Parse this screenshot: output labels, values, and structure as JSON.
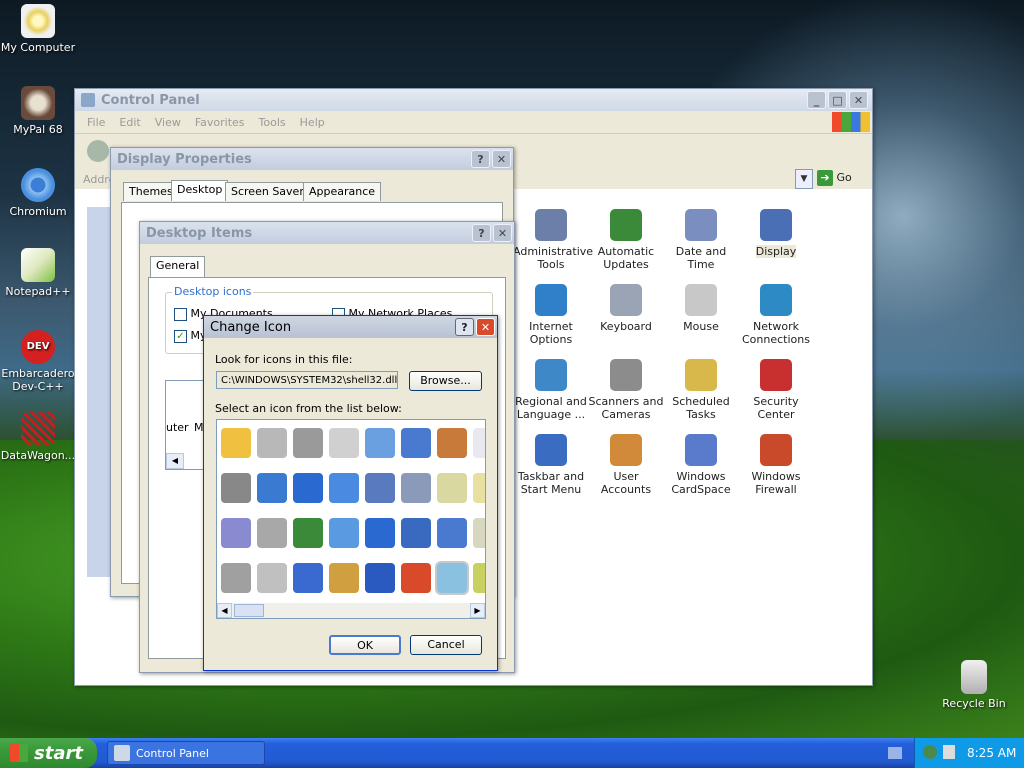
{
  "desktop": {
    "icons": [
      {
        "label": "My Computer"
      },
      {
        "label": "MyPal 68"
      },
      {
        "label": "Chromium"
      },
      {
        "label": "Notepad++"
      },
      {
        "label": "Embarcadero Dev-C++"
      },
      {
        "label": "DataWagon..."
      },
      {
        "label": "Recycle Bin"
      }
    ]
  },
  "control_panel": {
    "title": "Control Panel",
    "menu": [
      "File",
      "Edit",
      "View",
      "Favorites",
      "Tools",
      "Help"
    ],
    "address_label": "Addre",
    "go_label": "Go",
    "items": [
      {
        "label": "Administrative Tools",
        "color": "#6c7fa8"
      },
      {
        "label": "Automatic Updates",
        "color": "#3a8a3a"
      },
      {
        "label": "Date and Time",
        "color": "#7a8fbf"
      },
      {
        "label": "Display",
        "color": "#4a6fb5"
      },
      {
        "label": "Internet Options",
        "color": "#2f7fc9"
      },
      {
        "label": "Keyboard",
        "color": "#9aa4b5"
      },
      {
        "label": "Mouse",
        "color": "#c8c8c8"
      },
      {
        "label": "Network Connections",
        "color": "#2e8ac4"
      },
      {
        "label": "Regional and Language ...",
        "color": "#3f88c8"
      },
      {
        "label": "Scanners and Cameras",
        "color": "#8c8c8c"
      },
      {
        "label": "Scheduled Tasks",
        "color": "#d8b84a"
      },
      {
        "label": "Security Center",
        "color": "#c83030"
      },
      {
        "label": "Taskbar and Start Menu",
        "color": "#3a6cc2"
      },
      {
        "label": "User Accounts",
        "color": "#d08a3a"
      },
      {
        "label": "Windows CardSpace",
        "color": "#5a7acb"
      },
      {
        "label": "Windows Firewall",
        "color": "#c84a2a"
      }
    ]
  },
  "display_props": {
    "title": "Display Properties",
    "tabs": [
      "Themes",
      "Desktop",
      "Screen Saver",
      "Appearance"
    ]
  },
  "desktop_items": {
    "title": "Desktop Items",
    "tab": "General",
    "group_label": "Desktop icons",
    "checkboxes": [
      {
        "label": "My Documents",
        "checked": false
      },
      {
        "label": "My Network Places",
        "checked": false
      },
      {
        "label": "My",
        "checked": true
      }
    ],
    "list_text_1": "uter",
    "list_text_2": "M"
  },
  "change_icon": {
    "title": "Change Icon",
    "look_label": "Look for icons in this file:",
    "file_path": "C:\\WINDOWS\\SYSTEM32\\shell32.dll",
    "browse_label": "Browse...",
    "select_label": "Select an icon from the list below:",
    "ok_label": "OK",
    "cancel_label": "Cancel"
  },
  "taskbar": {
    "start_label": "start",
    "task_label": "Control Panel",
    "clock": "8:25 AM"
  }
}
